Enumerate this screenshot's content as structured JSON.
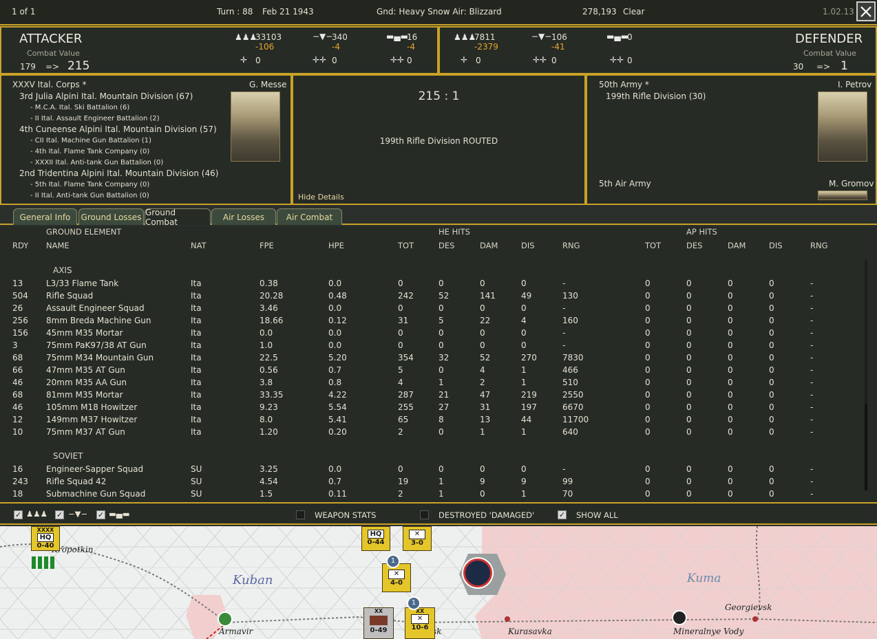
{
  "topbar": {
    "page": "1 of 1",
    "turn": "Turn : 88",
    "date": "Feb 21 1943",
    "weather": "Gnd: Heavy Snow  Air: Blizzard",
    "coords": "278,193",
    "sky": "Clear",
    "version": "1.02.13",
    "close_icon": "close-x-icon"
  },
  "attacker": {
    "title": "ATTACKER",
    "cv_label": "Combat Value",
    "cv_from": "179",
    "arrow": "=>",
    "cv_to": "215",
    "men": "33103",
    "men_loss": "-106",
    "guns": "340",
    "guns_loss": "-4",
    "tanks": "16",
    "tanks_loss": "-4",
    "air1": "0",
    "air2": "0",
    "air3": "0"
  },
  "defender": {
    "title": "DEFENDER",
    "cv_label": "Combat Value",
    "cv_from": "30",
    "arrow": "=>",
    "cv_to": "1",
    "men": "7811",
    "men_loss": "-2379",
    "guns": "106",
    "guns_loss": "-41",
    "tanks": "0",
    "air1": "0",
    "air2": "0",
    "air3": "0"
  },
  "att_oob": {
    "corps": "XXXV Ital. Corps *",
    "commander": "G. Messe",
    "lines": [
      {
        "t": "3rd Julia Alpini Ital. Mountain Division (67)",
        "s": false
      },
      {
        "t": "- M.C.A. Ital. Ski Battalion (6)",
        "s": true
      },
      {
        "t": "- II Ital. Assault Engineer Battalion (2)",
        "s": true
      },
      {
        "t": "4th Cuneense Alpini Ital. Mountain Division (57)",
        "s": false
      },
      {
        "t": "- CII Ital. Machine Gun Battalion (1)",
        "s": true
      },
      {
        "t": "- 4th Ital. Flame Tank Company (0)",
        "s": true
      },
      {
        "t": "- XXXII Ital. Anti-tank Gun Battalion (0)",
        "s": true
      },
      {
        "t": "2nd Tridentina Alpini Ital. Mountain Division (46)",
        "s": false
      },
      {
        "t": "- 5th Ital. Flame Tank Company (0)",
        "s": true
      },
      {
        "t": "- II Ital. Anti-tank Gun Battalion (0)",
        "s": true
      }
    ]
  },
  "result": {
    "ratio": "215 : 1",
    "message": "199th Rifle Division ROUTED",
    "hide": "Hide Details"
  },
  "def_oob": {
    "army": "50th Army *",
    "commander": "I. Petrov",
    "division": "199th Rifle Division (30)",
    "air_army": "5th Air Army",
    "air_commander": "M. Gromov"
  },
  "tabs": [
    "General Info",
    "Ground Losses",
    "Ground Combat",
    "Air Losses",
    "Air Combat"
  ],
  "active_tab": 2,
  "table": {
    "group_ground": "GROUND ELEMENT",
    "group_he": "HE HITS",
    "group_ap": "AP HITS",
    "headers": [
      "RDY",
      "NAME",
      "NAT",
      "FPE",
      "HPE",
      "TOT",
      "DES",
      "DAM",
      "DIS",
      "RNG",
      "TOT",
      "DES",
      "DAM",
      "DIS",
      "RNG"
    ],
    "axis_label": "AXIS",
    "soviet_label": "SOVIET",
    "axis_rows": [
      [
        "13",
        "L3/33 Flame Tank",
        "Ita",
        "0.38",
        "0.0",
        "0",
        "0",
        "0",
        "0",
        "-",
        "0",
        "0",
        "0",
        "0",
        "-"
      ],
      [
        "504",
        "Rifle Squad",
        "Ita",
        "20.28",
        "0.48",
        "242",
        "52",
        "141",
        "49",
        "130",
        "0",
        "0",
        "0",
        "0",
        "-"
      ],
      [
        "26",
        "Assault Engineer Squad",
        "Ita",
        "3.46",
        "0.0",
        "0",
        "0",
        "0",
        "0",
        "-",
        "0",
        "0",
        "0",
        "0",
        "-"
      ],
      [
        "256",
        "8mm Breda Machine Gun",
        "Ita",
        "18.66",
        "0.12",
        "31",
        "5",
        "22",
        "4",
        "160",
        "0",
        "0",
        "0",
        "0",
        "-"
      ],
      [
        "156",
        "45mm M35 Mortar",
        "Ita",
        "0.0",
        "0.0",
        "0",
        "0",
        "0",
        "0",
        "-",
        "0",
        "0",
        "0",
        "0",
        "-"
      ],
      [
        "3",
        "75mm PaK97/38 AT Gun",
        "Ita",
        "1.0",
        "0.0",
        "0",
        "0",
        "0",
        "0",
        "-",
        "0",
        "0",
        "0",
        "0",
        "-"
      ],
      [
        "68",
        "75mm M34 Mountain Gun",
        "Ita",
        "22.5",
        "5.20",
        "354",
        "32",
        "52",
        "270",
        "7830",
        "0",
        "0",
        "0",
        "0",
        "-"
      ],
      [
        "66",
        "47mm M35 AT Gun",
        "Ita",
        "0.56",
        "0.7",
        "5",
        "0",
        "4",
        "1",
        "466",
        "0",
        "0",
        "0",
        "0",
        "-"
      ],
      [
        "46",
        "20mm M35 AA Gun",
        "Ita",
        "3.8",
        "0.8",
        "4",
        "1",
        "2",
        "1",
        "510",
        "0",
        "0",
        "0",
        "0",
        "-"
      ],
      [
        "68",
        "81mm M35 Mortar",
        "Ita",
        "33.35",
        "4.22",
        "287",
        "21",
        "47",
        "219",
        "2550",
        "0",
        "0",
        "0",
        "0",
        "-"
      ],
      [
        "46",
        "105mm M18 Howitzer",
        "Ita",
        "9.23",
        "5.54",
        "255",
        "27",
        "31",
        "197",
        "6670",
        "0",
        "0",
        "0",
        "0",
        "-"
      ],
      [
        "12",
        "149mm M37 Howitzer",
        "Ita",
        "8.0",
        "5.41",
        "65",
        "8",
        "13",
        "44",
        "11700",
        "0",
        "0",
        "0",
        "0",
        "-"
      ],
      [
        "10",
        "75mm M37 AT Gun",
        "Ita",
        "1.20",
        "0.20",
        "2",
        "0",
        "1",
        "1",
        "640",
        "0",
        "0",
        "0",
        "0",
        "-"
      ]
    ],
    "soviet_rows": [
      [
        "16",
        "Engineer-Sapper Squad",
        "SU",
        "3.25",
        "0.0",
        "0",
        "0",
        "0",
        "0",
        "-",
        "0",
        "0",
        "0",
        "0",
        "-"
      ],
      [
        "243",
        "Rifle Squad 42",
        "SU",
        "4.54",
        "0.7",
        "19",
        "1",
        "9",
        "9",
        "99",
        "0",
        "0",
        "0",
        "0",
        "-"
      ],
      [
        "18",
        "Submachine Gun Squad",
        "SU",
        "1.5",
        "0.11",
        "2",
        "1",
        "0",
        "1",
        "70",
        "0",
        "0",
        "0",
        "0",
        "-"
      ]
    ]
  },
  "filters": {
    "men_checked": true,
    "guns_checked": true,
    "tanks_checked": true,
    "weapon_stats": "WEAPON STATS",
    "weapon_stats_checked": false,
    "destroyed": "DESTROYED 'DAMAGED'",
    "destroyed_checked": false,
    "show_all": "SHOW ALL",
    "show_all_checked": true
  },
  "map": {
    "labels": {
      "kropotkin": "Kropotkin",
      "kuban": "Kuban",
      "kuma": "Kuma",
      "armavir": "Armavir",
      "kurasavka": "Kurasavka",
      "georgievsk": "Georgievsk",
      "mineralnye": "Mineralnye Vody",
      "nevinnomyssk": "sk"
    },
    "counters": [
      {
        "top": "XXXX",
        "mid": "HQ",
        "val": "0-40"
      },
      {
        "top": "",
        "mid": "HQ",
        "val": "0-44"
      },
      {
        "top": "",
        "mid": "",
        "val": "3-0"
      },
      {
        "top": "",
        "mid": "",
        "val": "4-0"
      },
      {
        "top": "XX",
        "mid": "",
        "val": "0-49"
      },
      {
        "top": "XX",
        "mid": "",
        "val": "10-6"
      }
    ],
    "badge1": "1",
    "badge2": "1"
  }
}
